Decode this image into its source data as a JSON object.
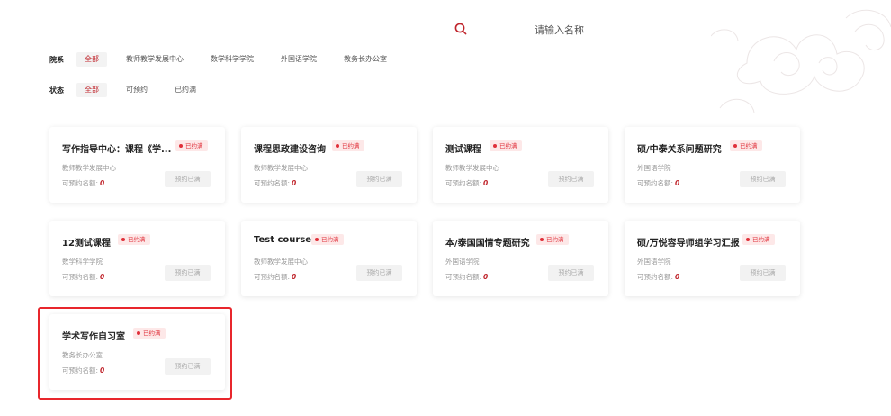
{
  "search": {
    "placeholder": "请输入名称"
  },
  "filters": {
    "department": {
      "label": "院系",
      "options": [
        "全部",
        "教师教学发展中心",
        "数学科学学院",
        "外国语学院",
        "教务长办公室"
      ]
    },
    "status": {
      "label": "状态",
      "options": [
        "全部",
        "可预约",
        "已约满"
      ]
    }
  },
  "quota_label": "可预约名额:",
  "cards": [
    {
      "title": "写作指导中心：课程《学...",
      "badge": "已约满",
      "dept": "教师教学发展中心",
      "quota": "0",
      "button": "预约已满"
    },
    {
      "title": "课程思政建设咨询",
      "badge": "已约满",
      "dept": "教师教学发展中心",
      "quota": "0",
      "button": "预约已满"
    },
    {
      "title": "测试课程",
      "badge": "已约满",
      "dept": "教师教学发展中心",
      "quota": "0",
      "button": "预约已满"
    },
    {
      "title": "硕/中泰关系问题研究",
      "badge": "已约满",
      "dept": "外国语学院",
      "quota": "0",
      "button": "预约已满"
    },
    {
      "title": "12测试课程",
      "badge": "已约满",
      "dept": "数学科学学院",
      "quota": "0",
      "button": "预约已满"
    },
    {
      "title": "Test course",
      "badge": "已约满",
      "dept": "教师教学发展中心",
      "quota": "0",
      "button": "预约已满"
    },
    {
      "title": "本/泰国国情专题研究",
      "badge": "已约满",
      "dept": "外国语学院",
      "quota": "0",
      "button": "预约已满"
    },
    {
      "title": "硕/万悦容导师组学习汇报",
      "badge": "已约满",
      "dept": "外国语学院",
      "quota": "0",
      "button": "预约已满"
    },
    {
      "title": "学术写作自习室",
      "badge": "已约满",
      "dept": "教务长办公室",
      "quota": "0",
      "button": "预约已满"
    }
  ],
  "colors": {
    "accent": "#c0262d",
    "badge_bg": "#fde8e8",
    "highlight": "#e8262c"
  }
}
